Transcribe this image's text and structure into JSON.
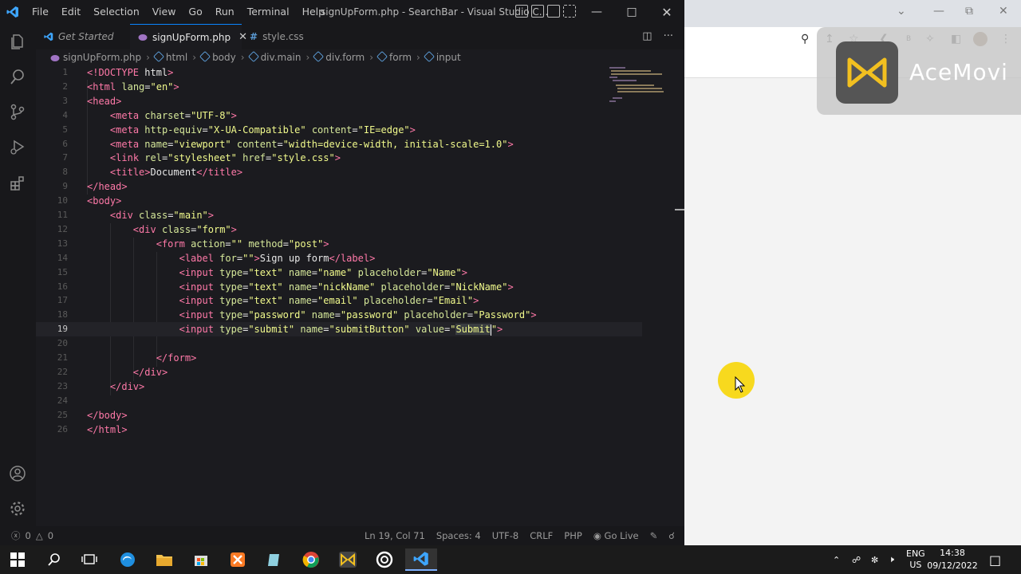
{
  "vscode": {
    "menu": [
      "File",
      "Edit",
      "Selection",
      "View",
      "Go",
      "Run",
      "Terminal",
      "Help"
    ],
    "title": "signUpForm.php - SearchBar - Visual Studio C...",
    "tabs": [
      {
        "label": "Get Started",
        "icon": "vscode-icon",
        "active": false
      },
      {
        "label": "signUpForm.php",
        "icon": "php-icon",
        "active": true
      },
      {
        "label": "style.css",
        "icon": "hash-icon",
        "active": false
      }
    ],
    "breadcrumb": [
      "signUpForm.php",
      "html",
      "body",
      "div.main",
      "div.form",
      "form",
      "input"
    ],
    "code_lines": [
      [
        [
          "t-punct",
          "<!"
        ],
        [
          "t-tag",
          "DOCTYPE"
        ],
        [
          "t-text",
          " html"
        ],
        [
          "t-punct",
          ">"
        ]
      ],
      [
        [
          "t-punct",
          "<"
        ],
        [
          "t-tag",
          "html"
        ],
        [
          "t-attr",
          " lang"
        ],
        [
          "t-text",
          "="
        ],
        [
          "t-str",
          "\"en\""
        ],
        [
          "t-punct",
          ">"
        ]
      ],
      [
        [
          "t-punct",
          "<"
        ],
        [
          "t-tag",
          "head"
        ],
        [
          "t-punct",
          ">"
        ]
      ],
      [
        [
          "t-text",
          "    "
        ],
        [
          "t-punct",
          "<"
        ],
        [
          "t-tag",
          "meta"
        ],
        [
          "t-attr",
          " charset"
        ],
        [
          "t-text",
          "="
        ],
        [
          "t-str",
          "\"UTF-8\""
        ],
        [
          "t-punct",
          ">"
        ]
      ],
      [
        [
          "t-text",
          "    "
        ],
        [
          "t-punct",
          "<"
        ],
        [
          "t-tag",
          "meta"
        ],
        [
          "t-attr",
          " http-equiv"
        ],
        [
          "t-text",
          "="
        ],
        [
          "t-str",
          "\"X-UA-Compatible\""
        ],
        [
          "t-attr",
          " content"
        ],
        [
          "t-text",
          "="
        ],
        [
          "t-str",
          "\"IE=edge\""
        ],
        [
          "t-punct",
          ">"
        ]
      ],
      [
        [
          "t-text",
          "    "
        ],
        [
          "t-punct",
          "<"
        ],
        [
          "t-tag",
          "meta"
        ],
        [
          "t-attr",
          " name"
        ],
        [
          "t-text",
          "="
        ],
        [
          "t-str",
          "\"viewport\""
        ],
        [
          "t-attr",
          " content"
        ],
        [
          "t-text",
          "="
        ],
        [
          "t-str",
          "\"width=device-width, initial-scale=1.0\""
        ],
        [
          "t-punct",
          ">"
        ]
      ],
      [
        [
          "t-text",
          "    "
        ],
        [
          "t-punct",
          "<"
        ],
        [
          "t-tag",
          "link"
        ],
        [
          "t-attr",
          " rel"
        ],
        [
          "t-text",
          "="
        ],
        [
          "t-str",
          "\"stylesheet\""
        ],
        [
          "t-attr",
          " href"
        ],
        [
          "t-text",
          "="
        ],
        [
          "t-str",
          "\"style.css\""
        ],
        [
          "t-punct",
          ">"
        ]
      ],
      [
        [
          "t-text",
          "    "
        ],
        [
          "t-punct",
          "<"
        ],
        [
          "t-tag",
          "title"
        ],
        [
          "t-punct",
          ">"
        ],
        [
          "t-text",
          "Document"
        ],
        [
          "t-punct",
          "</"
        ],
        [
          "t-tag",
          "title"
        ],
        [
          "t-punct",
          ">"
        ]
      ],
      [
        [
          "t-punct",
          "</"
        ],
        [
          "t-tag",
          "head"
        ],
        [
          "t-punct",
          ">"
        ]
      ],
      [
        [
          "t-punct",
          "<"
        ],
        [
          "t-tag",
          "body"
        ],
        [
          "t-punct",
          ">"
        ]
      ],
      [
        [
          "t-text",
          "    "
        ],
        [
          "t-punct",
          "<"
        ],
        [
          "t-tag",
          "div"
        ],
        [
          "t-attr",
          " class"
        ],
        [
          "t-text",
          "="
        ],
        [
          "t-str",
          "\"main\""
        ],
        [
          "t-punct",
          ">"
        ]
      ],
      [
        [
          "t-text",
          "        "
        ],
        [
          "t-punct",
          "<"
        ],
        [
          "t-tag",
          "div"
        ],
        [
          "t-attr",
          " class"
        ],
        [
          "t-text",
          "="
        ],
        [
          "t-str",
          "\"form\""
        ],
        [
          "t-punct",
          ">"
        ]
      ],
      [
        [
          "t-text",
          "            "
        ],
        [
          "t-punct",
          "<"
        ],
        [
          "t-tag",
          "form"
        ],
        [
          "t-attr",
          " action"
        ],
        [
          "t-text",
          "="
        ],
        [
          "t-str",
          "\"\""
        ],
        [
          "t-attr",
          " method"
        ],
        [
          "t-text",
          "="
        ],
        [
          "t-str",
          "\"post\""
        ],
        [
          "t-punct",
          ">"
        ]
      ],
      [
        [
          "t-text",
          "                "
        ],
        [
          "t-punct",
          "<"
        ],
        [
          "t-tag",
          "label"
        ],
        [
          "t-attr",
          " for"
        ],
        [
          "t-text",
          "="
        ],
        [
          "t-str",
          "\"\""
        ],
        [
          "t-punct",
          ">"
        ],
        [
          "t-text",
          "Sign up form"
        ],
        [
          "t-punct",
          "</"
        ],
        [
          "t-tag",
          "label"
        ],
        [
          "t-punct",
          ">"
        ]
      ],
      [
        [
          "t-text",
          "                "
        ],
        [
          "t-punct",
          "<"
        ],
        [
          "t-tag",
          "input"
        ],
        [
          "t-attr",
          " type"
        ],
        [
          "t-text",
          "="
        ],
        [
          "t-str",
          "\"text\""
        ],
        [
          "t-attr",
          " name"
        ],
        [
          "t-text",
          "="
        ],
        [
          "t-str",
          "\"name\""
        ],
        [
          "t-attr",
          " placeholder"
        ],
        [
          "t-text",
          "="
        ],
        [
          "t-str",
          "\"Name\""
        ],
        [
          "t-punct",
          ">"
        ]
      ],
      [
        [
          "t-text",
          "                "
        ],
        [
          "t-punct",
          "<"
        ],
        [
          "t-tag",
          "input"
        ],
        [
          "t-attr",
          " type"
        ],
        [
          "t-text",
          "="
        ],
        [
          "t-str",
          "\"text\""
        ],
        [
          "t-attr",
          " name"
        ],
        [
          "t-text",
          "="
        ],
        [
          "t-str",
          "\"nickName\""
        ],
        [
          "t-attr",
          " placeholder"
        ],
        [
          "t-text",
          "="
        ],
        [
          "t-str",
          "\"NickName\""
        ],
        [
          "t-punct",
          ">"
        ]
      ],
      [
        [
          "t-text",
          "                "
        ],
        [
          "t-punct",
          "<"
        ],
        [
          "t-tag",
          "input"
        ],
        [
          "t-attr",
          " type"
        ],
        [
          "t-text",
          "="
        ],
        [
          "t-str",
          "\"text\""
        ],
        [
          "t-attr",
          " name"
        ],
        [
          "t-text",
          "="
        ],
        [
          "t-str",
          "\"email\""
        ],
        [
          "t-attr",
          " placeholder"
        ],
        [
          "t-text",
          "="
        ],
        [
          "t-str",
          "\"Email\""
        ],
        [
          "t-punct",
          ">"
        ]
      ],
      [
        [
          "t-text",
          "                "
        ],
        [
          "t-punct",
          "<"
        ],
        [
          "t-tag",
          "input"
        ],
        [
          "t-attr",
          " type"
        ],
        [
          "t-text",
          "="
        ],
        [
          "t-str",
          "\"password\""
        ],
        [
          "t-attr",
          " name"
        ],
        [
          "t-text",
          "="
        ],
        [
          "t-str",
          "\"password\""
        ],
        [
          "t-attr",
          " placeholder"
        ],
        [
          "t-text",
          "="
        ],
        [
          "t-str",
          "\"Password\""
        ],
        [
          "t-punct",
          ">"
        ]
      ],
      [
        [
          "t-text",
          "                "
        ],
        [
          "t-punct",
          "<"
        ],
        [
          "t-tag",
          "input"
        ],
        [
          "t-attr",
          " type"
        ],
        [
          "t-text",
          "="
        ],
        [
          "t-str",
          "\"submit\""
        ],
        [
          "t-attr",
          " name"
        ],
        [
          "t-text",
          "="
        ],
        [
          "t-str",
          "\"submitButton\""
        ],
        [
          "t-attr",
          " value"
        ],
        [
          "t-text",
          "="
        ],
        [
          "t-str",
          "\""
        ],
        [
          "sel",
          "Submit"
        ],
        [
          "cursor",
          ""
        ],
        [
          "t-str",
          "\""
        ],
        [
          "t-punct",
          ">"
        ]
      ],
      [],
      [
        [
          "t-text",
          "            "
        ],
        [
          "t-punct",
          "</"
        ],
        [
          "t-tag",
          "form"
        ],
        [
          "t-punct",
          ">"
        ]
      ],
      [
        [
          "t-text",
          "        "
        ],
        [
          "t-punct",
          "</"
        ],
        [
          "t-tag",
          "div"
        ],
        [
          "t-punct",
          ">"
        ]
      ],
      [
        [
          "t-text",
          "    "
        ],
        [
          "t-punct",
          "</"
        ],
        [
          "t-tag",
          "div"
        ],
        [
          "t-punct",
          ">"
        ]
      ],
      [],
      [
        [
          "t-punct",
          "</"
        ],
        [
          "t-tag",
          "body"
        ],
        [
          "t-punct",
          ">"
        ]
      ],
      [
        [
          "t-punct",
          "</"
        ],
        [
          "t-tag",
          "html"
        ],
        [
          "t-punct",
          ">"
        ]
      ]
    ],
    "current_line": 19,
    "status": {
      "errors": "0",
      "warnings": "0",
      "position": "Ln 19, Col 71",
      "spaces": "Spaces: 4",
      "encoding": "UTF-8",
      "eol": "CRLF",
      "language": "PHP",
      "golive": "Go Live"
    }
  },
  "browser": {
    "watermark_text": "AceMovi"
  },
  "taskbar": {
    "lang": "ENG",
    "region": "US",
    "time": "14:38",
    "date": "09/12/2022"
  },
  "colors": {
    "accent": "#0a84ff",
    "tag": "#ff79a8",
    "attr": "#d6e89a",
    "string": "#f1fa8c"
  }
}
